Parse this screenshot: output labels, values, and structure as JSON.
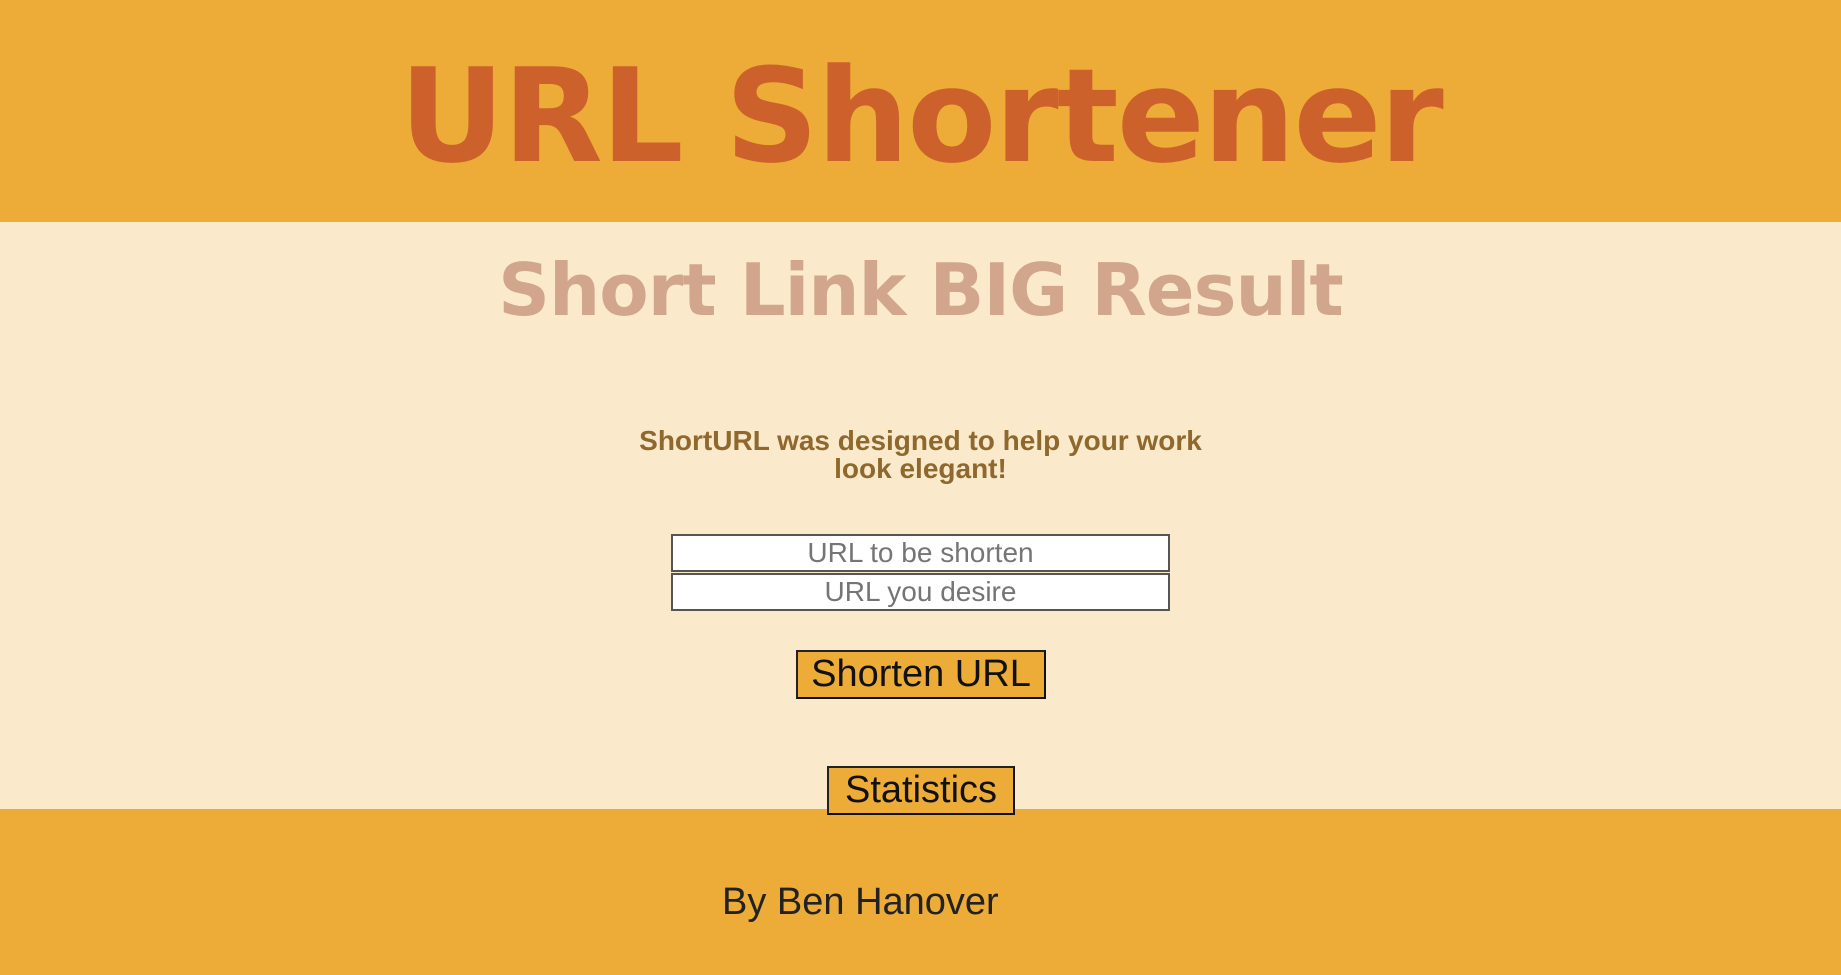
{
  "header": {
    "title": "URL Shortener"
  },
  "main": {
    "tagline": "Short Link BIG Result",
    "description": "ShortURL was designed to help your work look elegant!",
    "form": {
      "original_url_placeholder": "URL to be shorten",
      "desired_url_placeholder": "URL you desire",
      "submit_label": "Shorten URL"
    },
    "statistics_label": "Statistics"
  },
  "footer": {
    "author": "By Ben Hanover"
  },
  "colors": {
    "header_bg": "#edac37",
    "body_bg": "#faeacb",
    "title": "#cd612c",
    "tagline": "#d2a68c",
    "description": "#8e682d"
  }
}
